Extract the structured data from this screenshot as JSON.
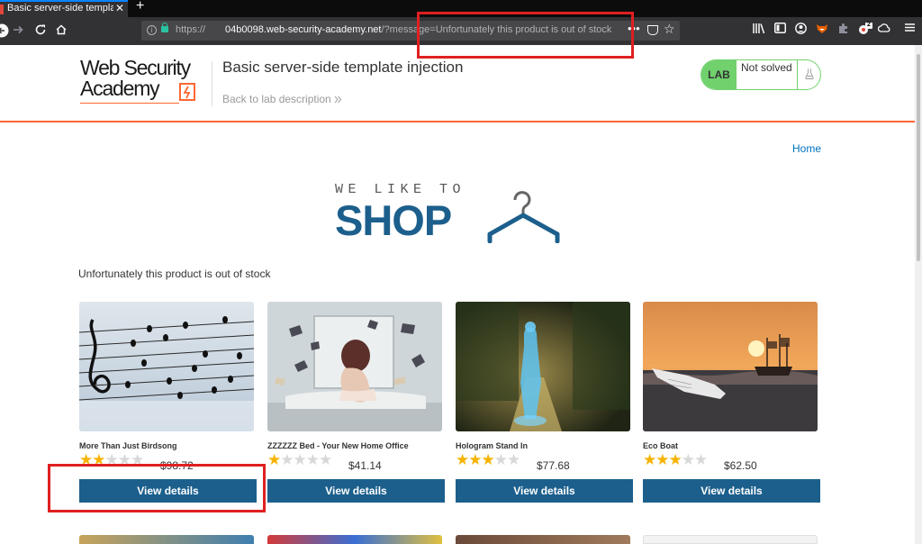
{
  "browser": {
    "tab_title": "Basic server-side templa",
    "tab_close": "✕",
    "new_tab": "+",
    "url_scheme": "https://",
    "url_host": "04b0098.web-security-academy.net",
    "url_path": "/?message=Unfortunately this product is out of stock",
    "url_dots": "•••",
    "extension_badge": "2"
  },
  "header": {
    "logo_line1": "Web Security",
    "logo_line2": "Academy",
    "lab_title": "Basic server-side template injection",
    "back_link": "Back to lab description",
    "status_lab": "LAB",
    "status_text": "Not solved"
  },
  "nav": {
    "home": "Home"
  },
  "banner": {
    "tagline": "WE LIKE TO",
    "word": "SHOP"
  },
  "message": "Unfortunately this product is out of stock",
  "products": [
    {
      "name": "More Than Just Birdsong",
      "rating": 2,
      "price": "$98.72",
      "button": "View details"
    },
    {
      "name": "ZZZZZZ Bed - Your New Home Office",
      "rating": 1,
      "price": "$41.14",
      "button": "View details"
    },
    {
      "name": "Hologram Stand In",
      "rating": 3,
      "price": "$77.68",
      "button": "View details"
    },
    {
      "name": "Eco Boat",
      "rating": 3,
      "price": "$62.50",
      "button": "View details"
    }
  ],
  "colors": {
    "accent": "#ff6633",
    "button": "#1c5f8c",
    "status_green": "#70d16d",
    "highlight": "#e02020"
  }
}
